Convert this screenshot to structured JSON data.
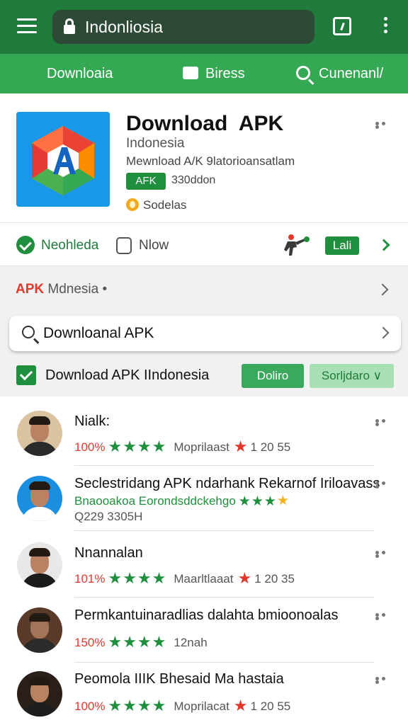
{
  "browser": {
    "url": "Indonliosia"
  },
  "nav": {
    "download": "Downloaia",
    "press": "Biress",
    "search": "Cunenanl/"
  },
  "app": {
    "title": "Download  APK",
    "subtitle": "Indonesia",
    "description": "Mewnload A/K 9latorioansatlam",
    "tag": "AFK",
    "size": "330ddon",
    "rating_label": "Sodelas"
  },
  "actions": {
    "installed": "Neohleda",
    "now": "Nlow",
    "lali": "Lali"
  },
  "section": {
    "site_prefix": "APK",
    "site_name": " Mdnesia •",
    "search_text": "Downloanal APK",
    "check_label": "Download APK IIndonesia",
    "button_primary": "Doliro",
    "button_secondary": "Sorljdaro ∨"
  },
  "reviews": [
    {
      "name": "Nialk:",
      "percent": "100%",
      "stars": "★★★★",
      "meta": "Moprilaast",
      "count": "1 20 55"
    },
    {
      "name": "Seclestridang APK ndarhank Rekarnof Iriloavass",
      "line2": "Bnaooakoa Eorondsddckehgo",
      "stars": "★★★",
      "line3": "Q229 3305H"
    },
    {
      "name": "Nnannalan",
      "percent": "101%",
      "stars": "★★★★",
      "meta": "Maarltlaaat",
      "count": "1 20 35"
    },
    {
      "name": "Permkantuinaradlias dalahta bmioonoalas",
      "percent": "150%",
      "stars": "★★★★",
      "meta": "12nah"
    },
    {
      "name": "Peomola IIIK Bhesaid Ma hastaia",
      "percent": "100%",
      "stars": "★★★★",
      "meta": "Moprilacat",
      "count": "1 20 55"
    }
  ],
  "colors": {
    "top_bar": "#1f7a3c",
    "nav_bar": "#34a853",
    "accent_green": "#1f8e3d",
    "accent_red": "#e0392b"
  }
}
